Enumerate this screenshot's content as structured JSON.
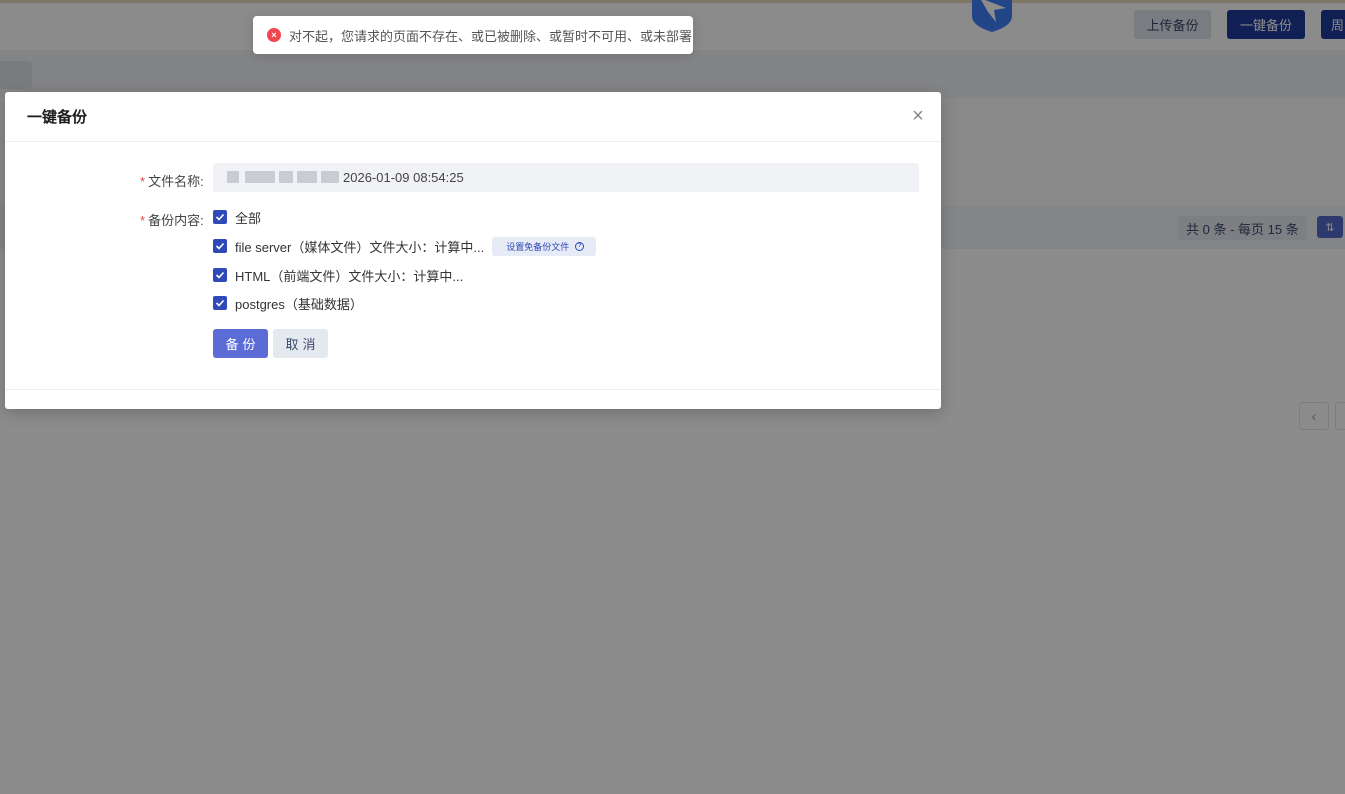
{
  "header": {
    "upload_backup": "上传备份",
    "one_key_backup": "一键备份",
    "cycle_backup": "周"
  },
  "table": {
    "page_info": "共 0 条 - 每页 15 条",
    "prev_page": "‹"
  },
  "toast": {
    "icon": "×",
    "message": "对不起，您请求的页面不存在、或已被删除、或暂时不可用、或未部署"
  },
  "dialog": {
    "title": "一键备份",
    "close": "×",
    "file_name_label": "文件名称:",
    "file_name_value": "2026-01-09 08:54:25",
    "content_label": "备份内容:",
    "required_mark": "*",
    "options": [
      {
        "label": "全部",
        "checked": true
      },
      {
        "label": "file server（媒体文件）文件大小：计算中...",
        "checked": true
      },
      {
        "label": "HTML（前端文件）文件大小：计算中...",
        "checked": true
      },
      {
        "label": "postgres（基础数据）",
        "checked": true
      }
    ],
    "exempt_button": "设置免备份文件",
    "help_icon": "?",
    "ok_button": "备份",
    "cancel_button": "取消"
  },
  "colors": {
    "primary": "#2f49b8",
    "primary_light": "#5b6cd6",
    "error": "#f0484e"
  }
}
